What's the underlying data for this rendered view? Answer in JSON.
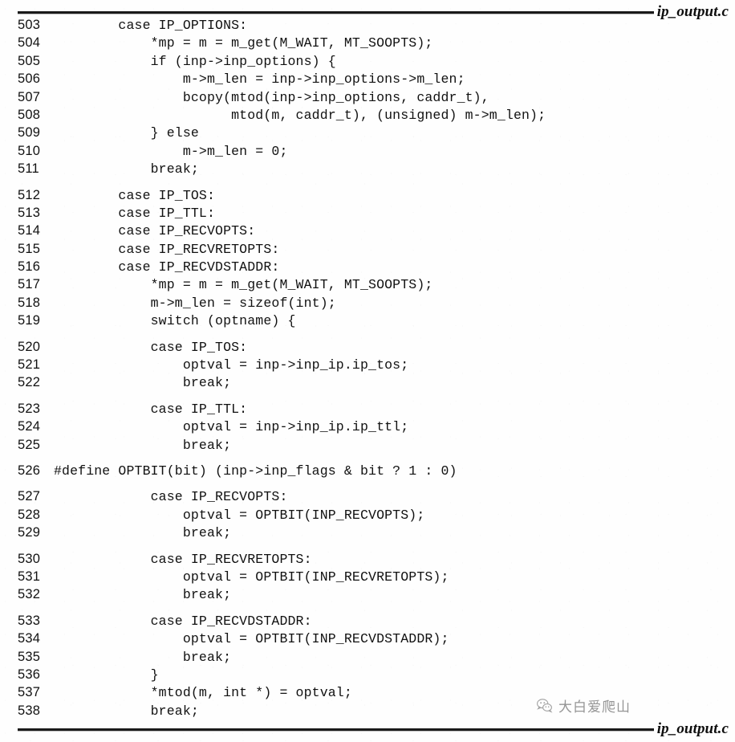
{
  "page": {
    "header_label": "ip_output.c",
    "footer_label": "ip_output.c",
    "language": "c",
    "file_name": "ip_output.c"
  },
  "watermark": {
    "icon": "wechat-icon",
    "text": "大白爱爬山"
  },
  "listing": {
    "first_line": 503,
    "last_line": 538,
    "lines": [
      {
        "n": "503",
        "code": "        case IP_OPTIONS:",
        "gap": false
      },
      {
        "n": "504",
        "code": "            *mp = m = m_get(M_WAIT, MT_SOOPTS);",
        "gap": false
      },
      {
        "n": "505",
        "code": "            if (inp->inp_options) {",
        "gap": false
      },
      {
        "n": "506",
        "code": "                m->m_len = inp->inp_options->m_len;",
        "gap": false
      },
      {
        "n": "507",
        "code": "                bcopy(mtod(inp->inp_options, caddr_t),",
        "gap": false
      },
      {
        "n": "508",
        "code": "                      mtod(m, caddr_t), (unsigned) m->m_len);",
        "gap": false
      },
      {
        "n": "509",
        "code": "            } else",
        "gap": false
      },
      {
        "n": "510",
        "code": "                m->m_len = 0;",
        "gap": false
      },
      {
        "n": "511",
        "code": "            break;",
        "gap": false
      },
      {
        "n": "512",
        "code": "        case IP_TOS:",
        "gap": true
      },
      {
        "n": "513",
        "code": "        case IP_TTL:",
        "gap": false
      },
      {
        "n": "514",
        "code": "        case IP_RECVOPTS:",
        "gap": false
      },
      {
        "n": "515",
        "code": "        case IP_RECVRETOPTS:",
        "gap": false
      },
      {
        "n": "516",
        "code": "        case IP_RECVDSTADDR:",
        "gap": false
      },
      {
        "n": "517",
        "code": "            *mp = m = m_get(M_WAIT, MT_SOOPTS);",
        "gap": false
      },
      {
        "n": "518",
        "code": "            m->m_len = sizeof(int);",
        "gap": false
      },
      {
        "n": "519",
        "code": "            switch (optname) {",
        "gap": false
      },
      {
        "n": "520",
        "code": "            case IP_TOS:",
        "gap": true
      },
      {
        "n": "521",
        "code": "                optval = inp->inp_ip.ip_tos;",
        "gap": false
      },
      {
        "n": "522",
        "code": "                break;",
        "gap": false
      },
      {
        "n": "523",
        "code": "            case IP_TTL:",
        "gap": true
      },
      {
        "n": "524",
        "code": "                optval = inp->inp_ip.ip_ttl;",
        "gap": false
      },
      {
        "n": "525",
        "code": "                break;",
        "gap": false
      },
      {
        "n": "526",
        "code": "#define OPTBIT(bit) (inp->inp_flags & bit ? 1 : 0)",
        "gap": true
      },
      {
        "n": "527",
        "code": "            case IP_RECVOPTS:",
        "gap": true
      },
      {
        "n": "528",
        "code": "                optval = OPTBIT(INP_RECVOPTS);",
        "gap": false
      },
      {
        "n": "529",
        "code": "                break;",
        "gap": false
      },
      {
        "n": "530",
        "code": "            case IP_RECVRETOPTS:",
        "gap": true
      },
      {
        "n": "531",
        "code": "                optval = OPTBIT(INP_RECVRETOPTS);",
        "gap": false
      },
      {
        "n": "532",
        "code": "                break;",
        "gap": false
      },
      {
        "n": "533",
        "code": "            case IP_RECVDSTADDR:",
        "gap": true
      },
      {
        "n": "534",
        "code": "                optval = OPTBIT(INP_RECVDSTADDR);",
        "gap": false
      },
      {
        "n": "535",
        "code": "                break;",
        "gap": false
      },
      {
        "n": "536",
        "code": "            }",
        "gap": false
      },
      {
        "n": "537",
        "code": "            *mtod(m, int *) = optval;",
        "gap": false
      },
      {
        "n": "538",
        "code": "            break;",
        "gap": false
      }
    ]
  },
  "colors": {
    "page_background": "#fefefe",
    "text": "#111111",
    "rule": "#1a1a1a",
    "watermark": "#555555"
  }
}
